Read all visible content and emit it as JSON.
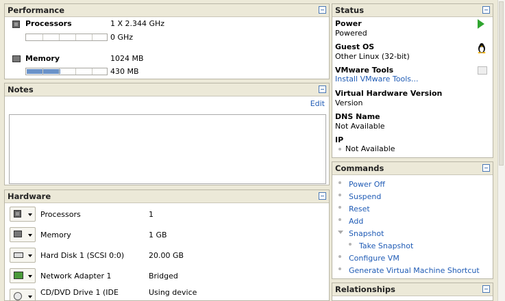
{
  "performance": {
    "title": "Performance",
    "processors_label": "Processors",
    "processors_value": "1 X 2.344 GHz",
    "processors_usage": "0 GHz",
    "processors_usage_fraction": 0.0,
    "memory_label": "Memory",
    "memory_value": "1024 MB",
    "memory_usage": "430 MB",
    "memory_usage_fraction": 0.42
  },
  "notes": {
    "title": "Notes",
    "edit_label": "Edit",
    "text": ""
  },
  "hardware": {
    "title": "Hardware",
    "rows": [
      {
        "label": "Processors",
        "value": "1",
        "icon": "cpu-icon"
      },
      {
        "label": "Memory",
        "value": "1 GB",
        "icon": "memory-icon"
      },
      {
        "label": "Hard Disk 1 (SCSI 0:0)",
        "value": "20.00 GB",
        "icon": "hard-disk-icon"
      },
      {
        "label": "Network Adapter 1",
        "value": "Bridged",
        "icon": "network-card-icon"
      },
      {
        "label": "CD/DVD Drive 1 (IDE",
        "value": "Using device",
        "icon": "cd-drive-icon"
      }
    ]
  },
  "status": {
    "title": "Status",
    "power_label": "Power",
    "power_value": "Powered",
    "guest_os_label": "Guest OS",
    "guest_os_value": "Other Linux (32-bit)",
    "tools_label": "VMware Tools",
    "tools_value": "Install VMware Tools...",
    "hw_version_label": "Virtual Hardware Version",
    "hw_version_value": "Version",
    "dns_label": "DNS Name",
    "dns_value": "Not Available",
    "ip_label": "IP",
    "ip_value": "Not Available"
  },
  "commands": {
    "title": "Commands",
    "items": [
      {
        "label": "Power Off"
      },
      {
        "label": "Suspend"
      },
      {
        "label": "Reset"
      },
      {
        "label": "Add"
      },
      {
        "label": "Snapshot"
      },
      {
        "label": "Take Snapshot"
      },
      {
        "label": "Configure VM"
      },
      {
        "label": "Generate Virtual Machine Shortcut"
      }
    ]
  },
  "relationships": {
    "title": "Relationships"
  },
  "colors": {
    "link": "#1f5bb5",
    "panel_header": "#ece9d8",
    "usage_bar": "#6b93c9",
    "power_on": "#2fa52f"
  }
}
